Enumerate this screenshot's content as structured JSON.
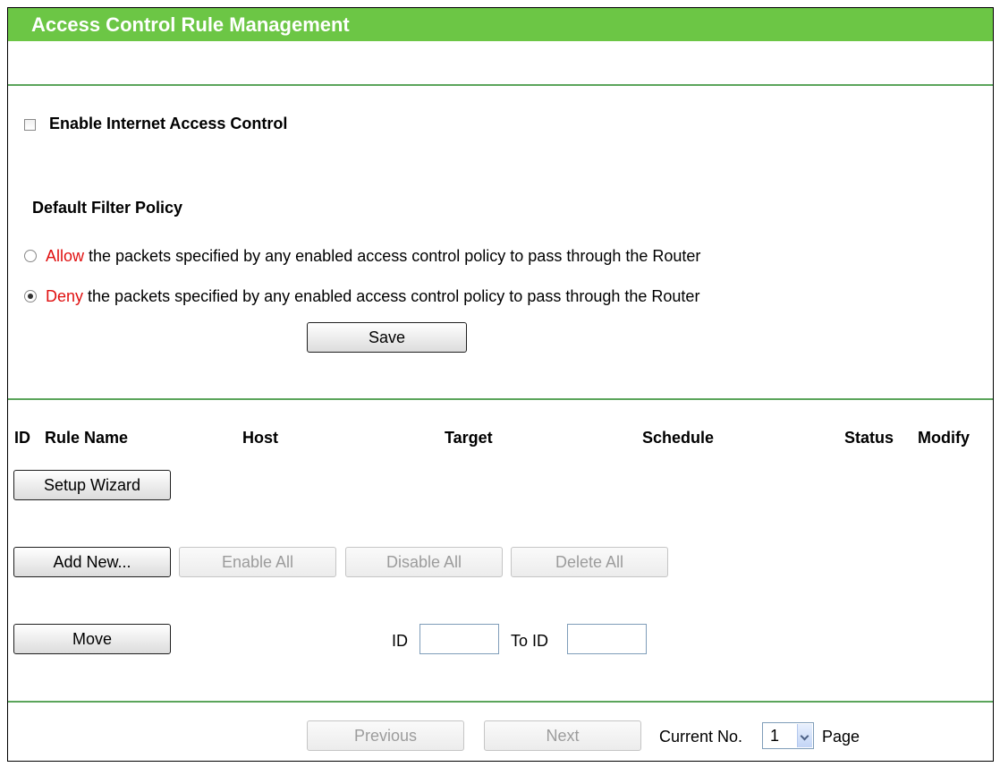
{
  "page": {
    "title": "Access Control Rule Management"
  },
  "internet_access": {
    "enable_label": "Enable Internet Access Control",
    "enabled": false
  },
  "filter_policy": {
    "heading": "Default Filter Policy",
    "allow_keyword": "Allow",
    "deny_keyword": "Deny",
    "option_suffix": " the packets specified by any enabled access control policy to pass through the Router",
    "selected": "deny",
    "save_label": "Save"
  },
  "rules_table": {
    "columns": [
      "ID",
      "Rule Name",
      "Host",
      "Target",
      "Schedule",
      "Status",
      "Modify"
    ],
    "rows": []
  },
  "actions": {
    "setup_wizard_label": "Setup Wizard",
    "add_new_label": "Add New...",
    "enable_all_label": "Enable All",
    "disable_all_label": "Disable All",
    "delete_all_label": "Delete All"
  },
  "move": {
    "button_label": "Move",
    "id_label": "ID",
    "id_value": "",
    "to_id_label": "To ID",
    "to_id_value": ""
  },
  "pagination": {
    "previous_label": "Previous",
    "next_label": "Next",
    "current_label": "Current No.",
    "current_value": "1",
    "page_label": "Page"
  },
  "colors": {
    "header_green": "#6cc645",
    "divider_green": "#5ba55b",
    "keyword_red": "#e01010"
  }
}
